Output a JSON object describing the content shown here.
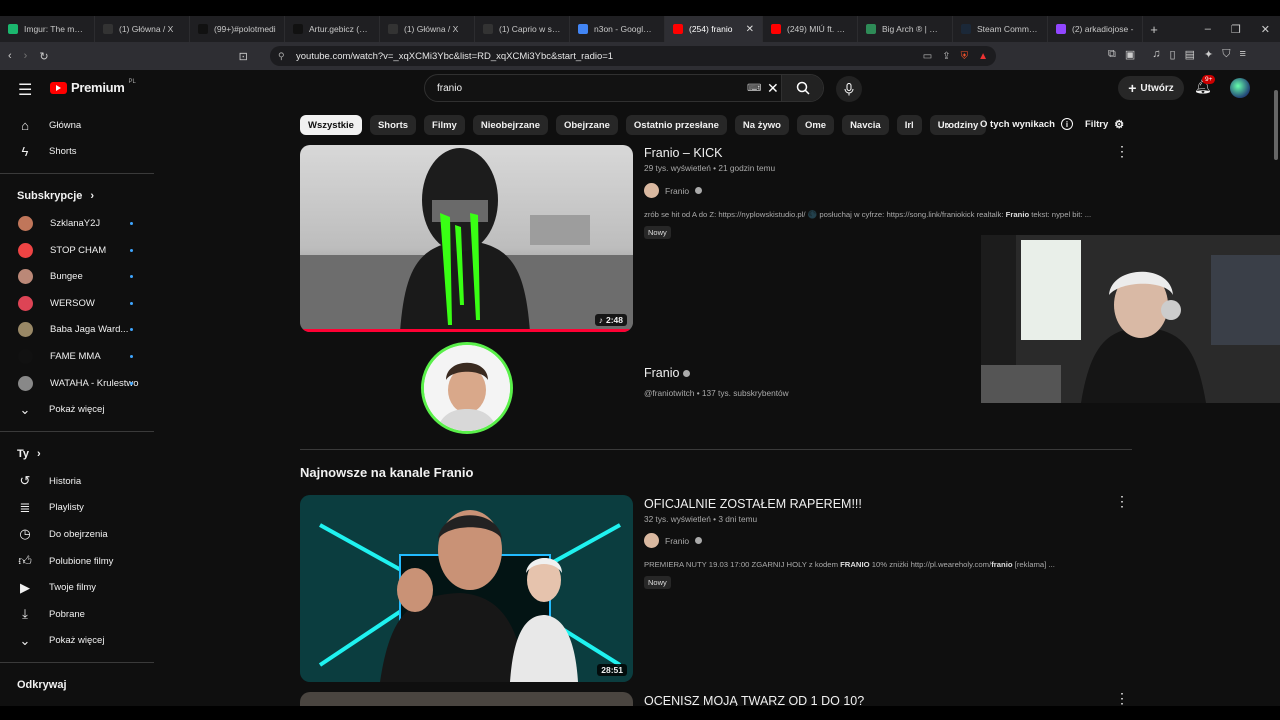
{
  "browser": {
    "tabs": [
      {
        "title": "Imgur: The magic",
        "color": "#1bb76e"
      },
      {
        "title": "(1) Główna / X",
        "color": "#333"
      },
      {
        "title": "(99+)#polotmedi",
        "color": "#111"
      },
      {
        "title": "Artur.gebicz (@a",
        "color": "#111"
      },
      {
        "title": "(1) Główna / X",
        "color": "#333"
      },
      {
        "title": "(1) Caprio w serw",
        "color": "#333"
      },
      {
        "title": "n3on - Google Se",
        "color": "#4285f4"
      },
      {
        "title": "(254) franio",
        "color": "#ff0000"
      },
      {
        "title": "(249) MIÚ ft. Pez",
        "color": "#ff0000"
      },
      {
        "title": "Big Arch ® | McD",
        "color": "#2e8b57"
      },
      {
        "title": "Steam Communi",
        "color": "#1b2838"
      },
      {
        "title": "(2) arkadiojose -",
        "color": "#9146ff"
      }
    ],
    "active_tab": 7,
    "url": "youtube.com/watch?v=_xqXCMi3Ybc&list=RD_xqXCMi3Ybc&start_radio=1"
  },
  "header": {
    "logo_text": "Premium",
    "logo_country": "PL",
    "search_value": "franio",
    "create_label": "Utwórz",
    "notif_count": "9+"
  },
  "sidebar": {
    "top": [
      {
        "label": "Główna",
        "icon": "home-icon"
      },
      {
        "label": "Shorts",
        "icon": "shorts-icon"
      }
    ],
    "subs_title": "Subskrypcje",
    "subs": [
      {
        "label": "SzklanaY2J",
        "color": "#c0765a"
      },
      {
        "label": "STOP CHAM",
        "color": "#e44"
      },
      {
        "label": "Bungee",
        "color": "#b87"
      },
      {
        "label": "WERSOW",
        "color": "#d45"
      },
      {
        "label": "Baba Jaga Ward...",
        "color": "#986"
      },
      {
        "label": "FAME MMA",
        "color": "#111"
      },
      {
        "label": "WATAHA - Krulestwo",
        "color": "#888"
      }
    ],
    "subs_more": "Pokaż więcej",
    "you_title": "Ty",
    "you": [
      {
        "label": "Historia",
        "icon": "history-icon"
      },
      {
        "label": "Playlisty",
        "icon": "playlist-icon"
      },
      {
        "label": "Do obejrzenia",
        "icon": "watch-later-icon"
      },
      {
        "label": "Polubione filmy",
        "icon": "like-icon"
      },
      {
        "label": "Twoje filmy",
        "icon": "your-videos-icon"
      },
      {
        "label": "Pobrane",
        "icon": "download-icon"
      }
    ],
    "you_more": "Pokaż więcej",
    "explore_title": "Odkrywaj"
  },
  "chips": [
    "Wszystkie",
    "Shorts",
    "Filmy",
    "Nieobejrzane",
    "Obejrzane",
    "Ostatnio przesłane",
    "Na żywo",
    "Ome",
    "Navcia",
    "Irl",
    "Urodziny"
  ],
  "chips_about": "O tych wynikach",
  "chips_filters": "Filtry",
  "video1": {
    "title": "Franio – KICK",
    "meta": "29 tys. wyświetleń • 21 godzin temu",
    "channel": "Franio",
    "desc_pre": "zrób se hit od A do Z: https://nyplowskistudio.pl/ 🌑 posłuchaj w cyfrze: https://song.link/franiokick realtalk: ",
    "desc_bold": "Franio",
    "desc_post": " tekst: nypel bit: ...",
    "badge": "Nowy",
    "duration": "2:48"
  },
  "channel_card": {
    "name": "Franio",
    "meta": "@franiotwitch • 137 tys. subskrybentów"
  },
  "section_title": "Najnowsze na kanale Franio",
  "video2": {
    "title": "OFICJALNIE ZOSTAŁEM RAPEREM!!!",
    "meta": "32 tys. wyświetleń • 3 dni temu",
    "channel": "Franio",
    "desc_pre": "PREMIERA NUTY 19.03 17:00 ZGARNIJ HOLY z kodem ",
    "desc_bold": "FRANIO",
    "desc_mid": " 10% zniżki http://pl.weareholy.com/",
    "desc_bold2": "franio",
    "desc_post": " [reklama] ...",
    "badge": "Nowy",
    "duration": "28:51"
  },
  "video3": {
    "title": "OCENISZ MOJĄ TWARZ OD 1 DO 10?"
  }
}
